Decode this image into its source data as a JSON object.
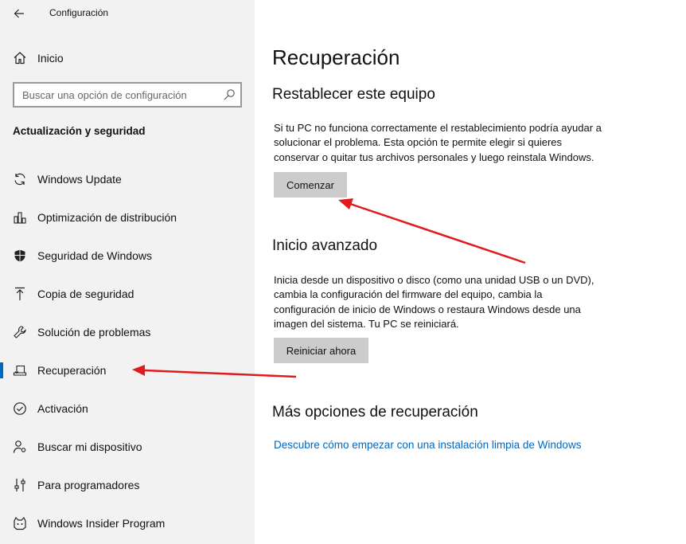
{
  "app": {
    "title": "Configuración"
  },
  "sidebar": {
    "home_label": "Inicio",
    "search_placeholder": "Buscar una opción de configuración",
    "section_title": "Actualización y seguridad",
    "items": [
      {
        "label": "Windows Update",
        "icon": "refresh-icon"
      },
      {
        "label": "Optimización de distribución",
        "icon": "delivery-optimization-icon"
      },
      {
        "label": "Seguridad de Windows",
        "icon": "shield-icon"
      },
      {
        "label": "Copia de seguridad",
        "icon": "upload-arrow-icon"
      },
      {
        "label": "Solución de problemas",
        "icon": "wrench-icon"
      },
      {
        "label": "Recuperación",
        "icon": "recovery-icon",
        "selected": true
      },
      {
        "label": "Activación",
        "icon": "check-circle-icon"
      },
      {
        "label": "Buscar mi dispositivo",
        "icon": "person-pin-icon"
      },
      {
        "label": "Para programadores",
        "icon": "developer-sliders-icon"
      },
      {
        "label": "Windows Insider Program",
        "icon": "insider-cat-icon"
      }
    ]
  },
  "main": {
    "title": "Recuperación",
    "reset": {
      "heading": "Restablecer este equipo",
      "text_lines": [
        "Si tu PC no funciona correctamente el restablecimiento podría ayudar a",
        "solucionar el problema. Esta opción te permite elegir si quieres",
        "conservar o quitar tus archivos personales y luego reinstala Windows."
      ],
      "button": "Comenzar"
    },
    "advanced": {
      "heading": "Inicio avanzado",
      "text_lines": [
        "Inicia desde un dispositivo o disco (como una unidad USB o un DVD),",
        "cambia la configuración del firmware del equipo, cambia la",
        "configuración de inicio de Windows o restaura Windows desde una",
        "imagen del sistema. Tu PC se reiniciará."
      ],
      "button": "Reiniciar ahora"
    },
    "more": {
      "heading": "Más opciones de recuperación",
      "link": "Descubre cómo empezar con una instalación limpia de Windows"
    }
  },
  "colors": {
    "accent": "#0067c0",
    "annotation_arrow": "#e01b1b",
    "sidebar_bg": "#f2f2f2",
    "button_bg": "#cccccc"
  }
}
